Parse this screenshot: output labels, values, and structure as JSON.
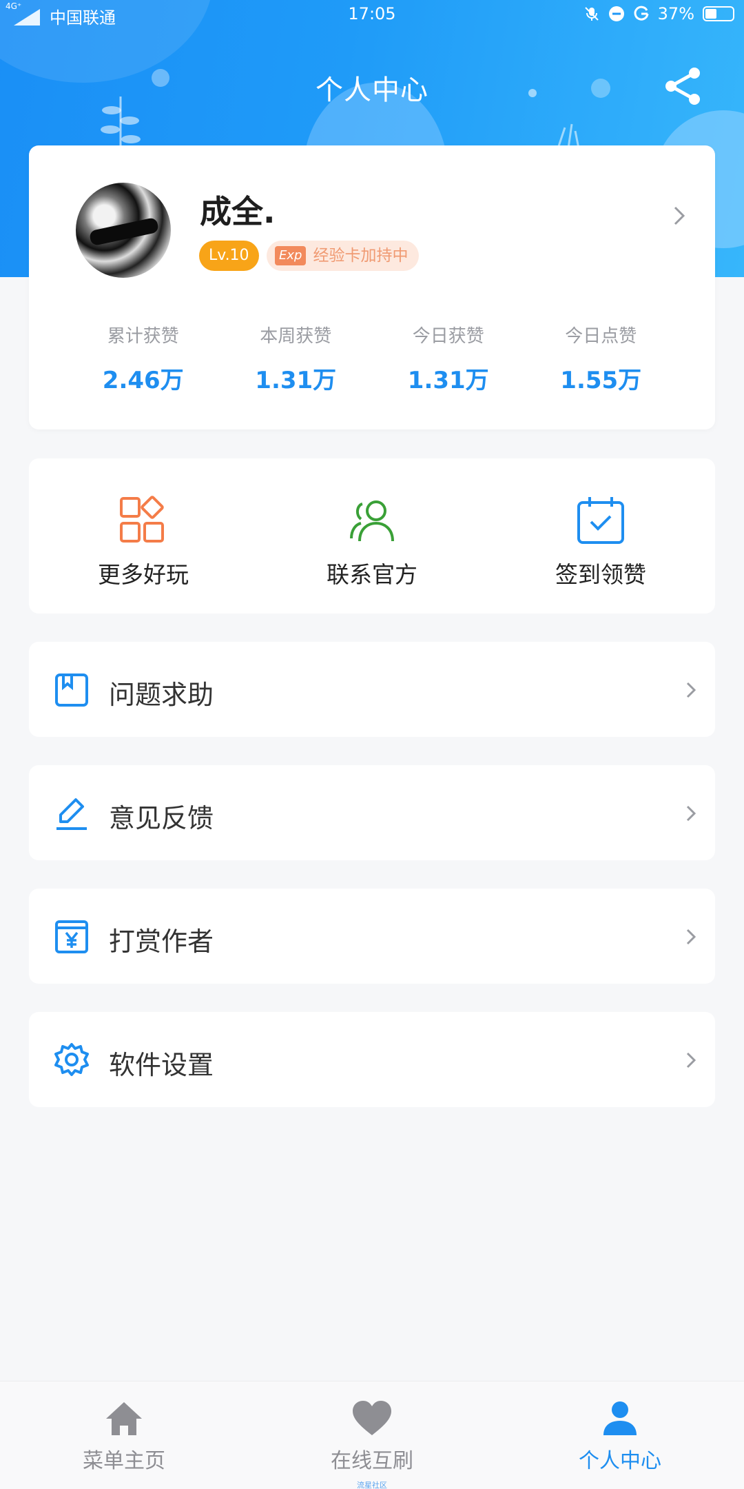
{
  "status_bar": {
    "network": "4G⁺",
    "carrier": "中国联通",
    "time": "17:05",
    "battery": "37%",
    "battery_level": 0.37
  },
  "header": {
    "title": "个人中心",
    "share_icon": "share-icon"
  },
  "profile": {
    "name": "成全.",
    "level": "Lv.10",
    "exp_tag": "Exp",
    "exp_text": "经验卡加持中"
  },
  "stats": [
    {
      "label": "累计获赞",
      "value": "2.46万"
    },
    {
      "label": "本周获赞",
      "value": "1.31万"
    },
    {
      "label": "今日获赞",
      "value": "1.31万"
    },
    {
      "label": "今日点赞",
      "value": "1.55万"
    }
  ],
  "quick_actions": [
    {
      "label": "更多好玩",
      "icon": "grid-icon"
    },
    {
      "label": "联系官方",
      "icon": "users-icon"
    },
    {
      "label": "签到领赞",
      "icon": "calendar-check-icon"
    }
  ],
  "menu": [
    {
      "label": "问题求助",
      "icon": "bookmark-icon"
    },
    {
      "label": "意见反馈",
      "icon": "edit-icon"
    },
    {
      "label": "打赏作者",
      "icon": "yen-icon"
    },
    {
      "label": "软件设置",
      "icon": "gear-icon"
    }
  ],
  "bottom_nav": {
    "items": [
      {
        "label": "菜单主页",
        "icon": "home-icon"
      },
      {
        "label": "在线互刷",
        "icon": "heart-icon",
        "sublabel": "流星社区"
      },
      {
        "label": "个人中心",
        "icon": "user-icon"
      }
    ],
    "active_index": 2
  },
  "colors": {
    "accent": "#1e8ef0",
    "level_badge": "#f8a418",
    "exp_badge_bg": "#fde9df",
    "grid_icon": "#f47c48",
    "users_icon": "#3aa037"
  }
}
